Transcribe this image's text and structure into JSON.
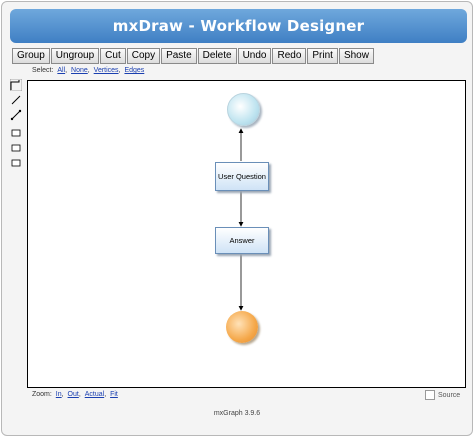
{
  "header": {
    "title": "mxDraw - Workflow Designer"
  },
  "toolbar": {
    "buttons": [
      "Group",
      "Ungroup",
      "Cut",
      "Copy",
      "Paste",
      "Delete",
      "Undo",
      "Redo",
      "Print",
      "Show"
    ]
  },
  "select": {
    "label": "Select:",
    "links": [
      "All",
      "None",
      "Vertices",
      "Edges"
    ]
  },
  "tools": [
    "connector-icon",
    "line-icon",
    "line-alt-icon",
    "rectangle-icon",
    "rectangle-icon",
    "rectangle-icon"
  ],
  "diagram": {
    "start_color": "#bfe4f0",
    "end_color": "#f5a84a",
    "node1_label": "User Question",
    "node2_label": "Answer"
  },
  "zoom": {
    "label": "Zoom:",
    "links": [
      "In",
      "Out",
      "Actual",
      "Fit"
    ]
  },
  "source_label": "Source",
  "footer": "mxGraph 3.9.6"
}
